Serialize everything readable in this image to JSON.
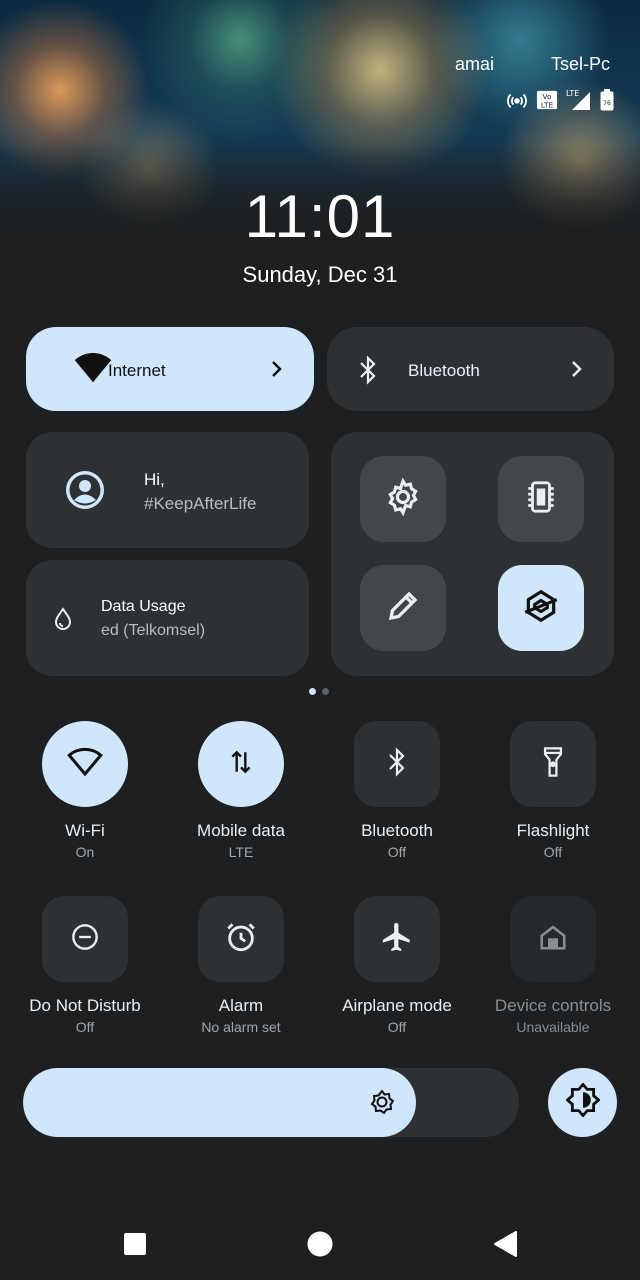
{
  "status_bar": {
    "carrier_1": "amai",
    "carrier_2": "Tsel-Pc",
    "icons": [
      "hotspot-icon",
      "volte-icon",
      "lte-signal-icon",
      "battery-icon"
    ],
    "battery_level": "76"
  },
  "lock": {
    "time": "11:01",
    "date": "Sunday, Dec 31"
  },
  "big_tiles": {
    "internet": {
      "label": "Internet",
      "icon": "wifi-icon",
      "state": "active"
    },
    "bluetooth": {
      "label": "Bluetooth",
      "icon": "bluetooth-icon",
      "state": "inactive"
    }
  },
  "user_card": {
    "greeting": "Hi,",
    "name": "#KeepAfterLife"
  },
  "data_card": {
    "title": "Data Usage",
    "subtitle": "ed (Telkomsel)"
  },
  "shortcuts": [
    "settings-icon",
    "chip-icon",
    "edit-icon",
    "vpn-icon"
  ],
  "page_indicator": {
    "current": 1,
    "total": 2
  },
  "tiles": [
    {
      "label": "Wi-Fi",
      "sub": "On",
      "icon": "wifi-icon",
      "state": "on"
    },
    {
      "label": "Mobile data",
      "sub": "LTE",
      "icon": "data-arrows-icon",
      "state": "on"
    },
    {
      "label": "Bluetooth",
      "sub": "Off",
      "icon": "bluetooth-icon",
      "state": "off"
    },
    {
      "label": "Flashlight",
      "sub": "Off",
      "icon": "flashlight-icon",
      "state": "off"
    },
    {
      "label": "Do Not Disturb",
      "sub": "Off",
      "icon": "dnd-icon",
      "state": "off"
    },
    {
      "label": "Alarm",
      "sub": "No alarm set",
      "icon": "alarm-icon",
      "state": "off"
    },
    {
      "label": "Airplane mode",
      "sub": "Off",
      "icon": "airplane-icon",
      "state": "off"
    },
    {
      "label": "Device controls",
      "sub": "Unavailable",
      "icon": "home-icon",
      "state": "unavailable"
    }
  ],
  "brightness": {
    "level_percent": 80
  },
  "colors": {
    "accent": "#cfe6fb",
    "panel": "#2e3134",
    "background": "#1d1f21"
  }
}
